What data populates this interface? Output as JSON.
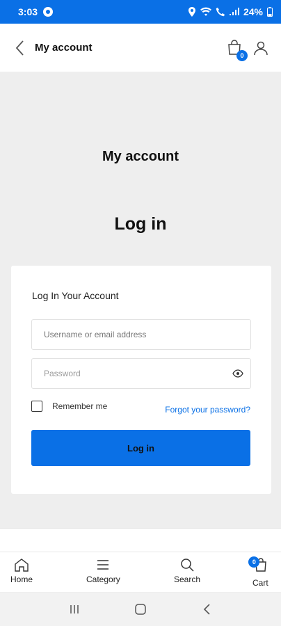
{
  "status_bar": {
    "time": "3:03",
    "battery": "24%"
  },
  "header": {
    "title": "My account",
    "cart_badge": "0"
  },
  "page": {
    "heading": "My account",
    "subheading": "Log in"
  },
  "login_form": {
    "title": "Log In Your Account",
    "username_placeholder": "Username or email address",
    "password_placeholder": "Password",
    "remember_label": "Remember me",
    "forgot_link": "Forgot your password?",
    "submit_label": "Log in"
  },
  "bottom_nav": {
    "items": [
      {
        "label": "Home",
        "icon": "home-icon"
      },
      {
        "label": "Category",
        "icon": "menu-icon"
      },
      {
        "label": "Search",
        "icon": "search-icon"
      },
      {
        "label": "Cart",
        "icon": "cart-icon"
      }
    ],
    "cart_badge": "0"
  },
  "colors": {
    "accent": "#0a70e6",
    "background": "#eeeeee",
    "card": "#ffffff"
  }
}
